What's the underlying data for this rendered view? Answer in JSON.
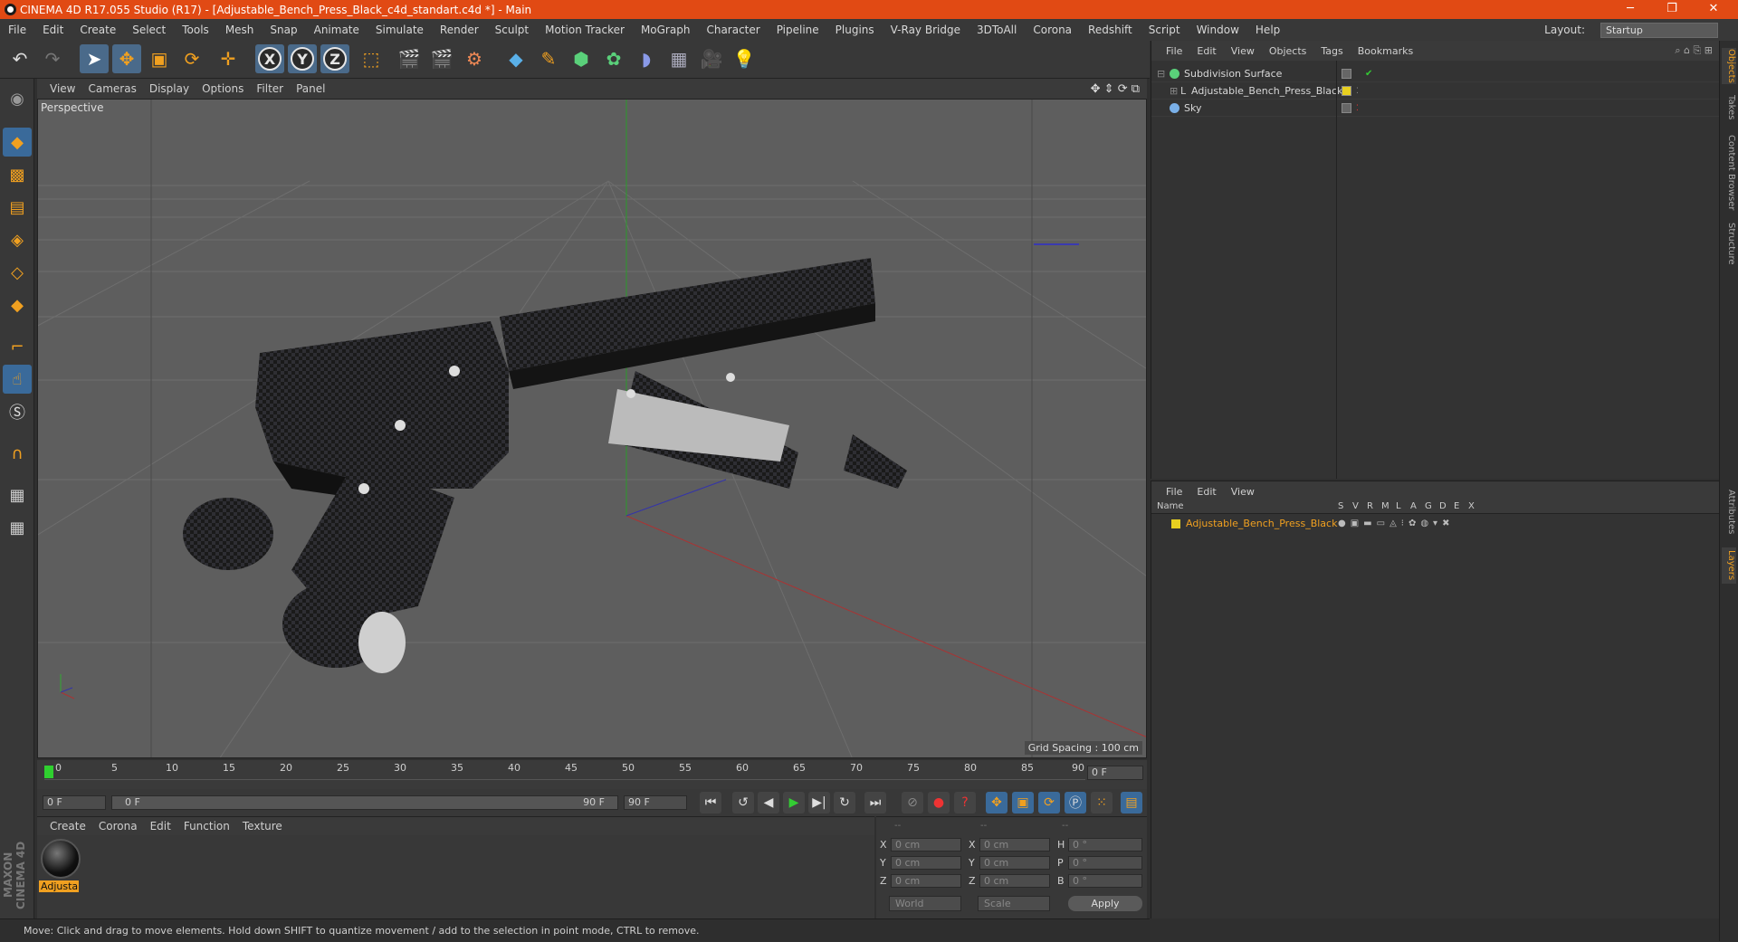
{
  "app": {
    "title": "CINEMA 4D R17.055 Studio (R17) - [Adjustable_Bench_Press_Black_c4d_standart.c4d *] - Main",
    "window_controls": {
      "minimize": "─",
      "restore": "❐",
      "close": "✕"
    }
  },
  "menu": [
    "File",
    "Edit",
    "Create",
    "Select",
    "Tools",
    "Mesh",
    "Snap",
    "Animate",
    "Simulate",
    "Render",
    "Sculpt",
    "Motion Tracker",
    "MoGraph",
    "Character",
    "Pipeline",
    "Plugins",
    "V-Ray Bridge",
    "3DToAll",
    "Corona",
    "Redshift",
    "Script",
    "Window",
    "Help"
  ],
  "layout": {
    "label": "Layout:",
    "value": "Startup"
  },
  "toolbar": {
    "axis_x": "X",
    "axis_y": "Y",
    "axis_z": "Z",
    "icons": [
      "undo-icon",
      "redo-icon",
      "select-arrow-icon",
      "move-icon",
      "scale-icon",
      "rotate-icon",
      "recent-tool-icon",
      "x-axis-icon",
      "y-axis-icon",
      "z-axis-icon",
      "world-coordinate-icon",
      "render-view-icon",
      "render-picture-viewer-icon",
      "render-settings-icon",
      "cube-icon",
      "pen-icon",
      "subdivision-icon",
      "cloner-icon",
      "deformer-icon",
      "floor-icon",
      "camera-icon",
      "light-icon"
    ]
  },
  "viewport": {
    "menu": [
      "View",
      "Cameras",
      "Display",
      "Options",
      "Filter",
      "Panel"
    ],
    "label": "Perspective",
    "grid_spacing": "Grid Spacing : 100 cm"
  },
  "timeline": {
    "ticks": [
      "0",
      "5",
      "10",
      "15",
      "20",
      "25",
      "30",
      "35",
      "40",
      "45",
      "50",
      "55",
      "60",
      "65",
      "70",
      "75",
      "80",
      "85",
      "90"
    ],
    "current_frame": "0 F",
    "start_field": "0 F",
    "range_start": "0 F",
    "range_end": "90 F",
    "end_field": "90 F"
  },
  "material_manager": {
    "menu": [
      "Create",
      "Corona",
      "Edit",
      "Function",
      "Texture"
    ],
    "material_label": "Adjusta"
  },
  "coordinates": {
    "header": [
      "--",
      "--",
      "--"
    ],
    "rows": [
      {
        "a": "X",
        "av": "0 cm",
        "b": "X",
        "bv": "0 cm",
        "c": "H",
        "cv": "0 °"
      },
      {
        "a": "Y",
        "av": "0 cm",
        "b": "Y",
        "bv": "0 cm",
        "c": "P",
        "cv": "0 °"
      },
      {
        "a": "Z",
        "av": "0 cm",
        "b": "Z",
        "bv": "0 cm",
        "c": "B",
        "cv": "0 °"
      }
    ],
    "mode_world": "World",
    "mode_scale": "Scale",
    "apply": "Apply"
  },
  "status": "Move: Click and drag to move elements. Hold down SHIFT to quantize movement / add to the selection in point mode, CTRL to remove.",
  "brand": "MAXON CINEMA 4D",
  "objects": {
    "menu": [
      "File",
      "Edit",
      "View",
      "Objects",
      "Tags",
      "Bookmarks"
    ],
    "items": [
      {
        "name": "Subdivision Surface"
      },
      {
        "name": "Adjustable_Bench_Press_Black"
      },
      {
        "name": "Sky"
      }
    ]
  },
  "layers": {
    "menu": [
      "File",
      "Edit",
      "View"
    ],
    "columns": [
      "Name",
      "S",
      "V",
      "R",
      "M",
      "L",
      "A",
      "G",
      "D",
      "E",
      "X"
    ],
    "row": "Adjustable_Bench_Press_Black"
  },
  "right_tabs": [
    "Objects",
    "Takes",
    "Content Browser",
    "Structure",
    "Attributes",
    "Layers"
  ],
  "colors": {
    "title_bar": "#e14a14",
    "accent": "#f0a020",
    "selection": "#4a6a8a"
  }
}
